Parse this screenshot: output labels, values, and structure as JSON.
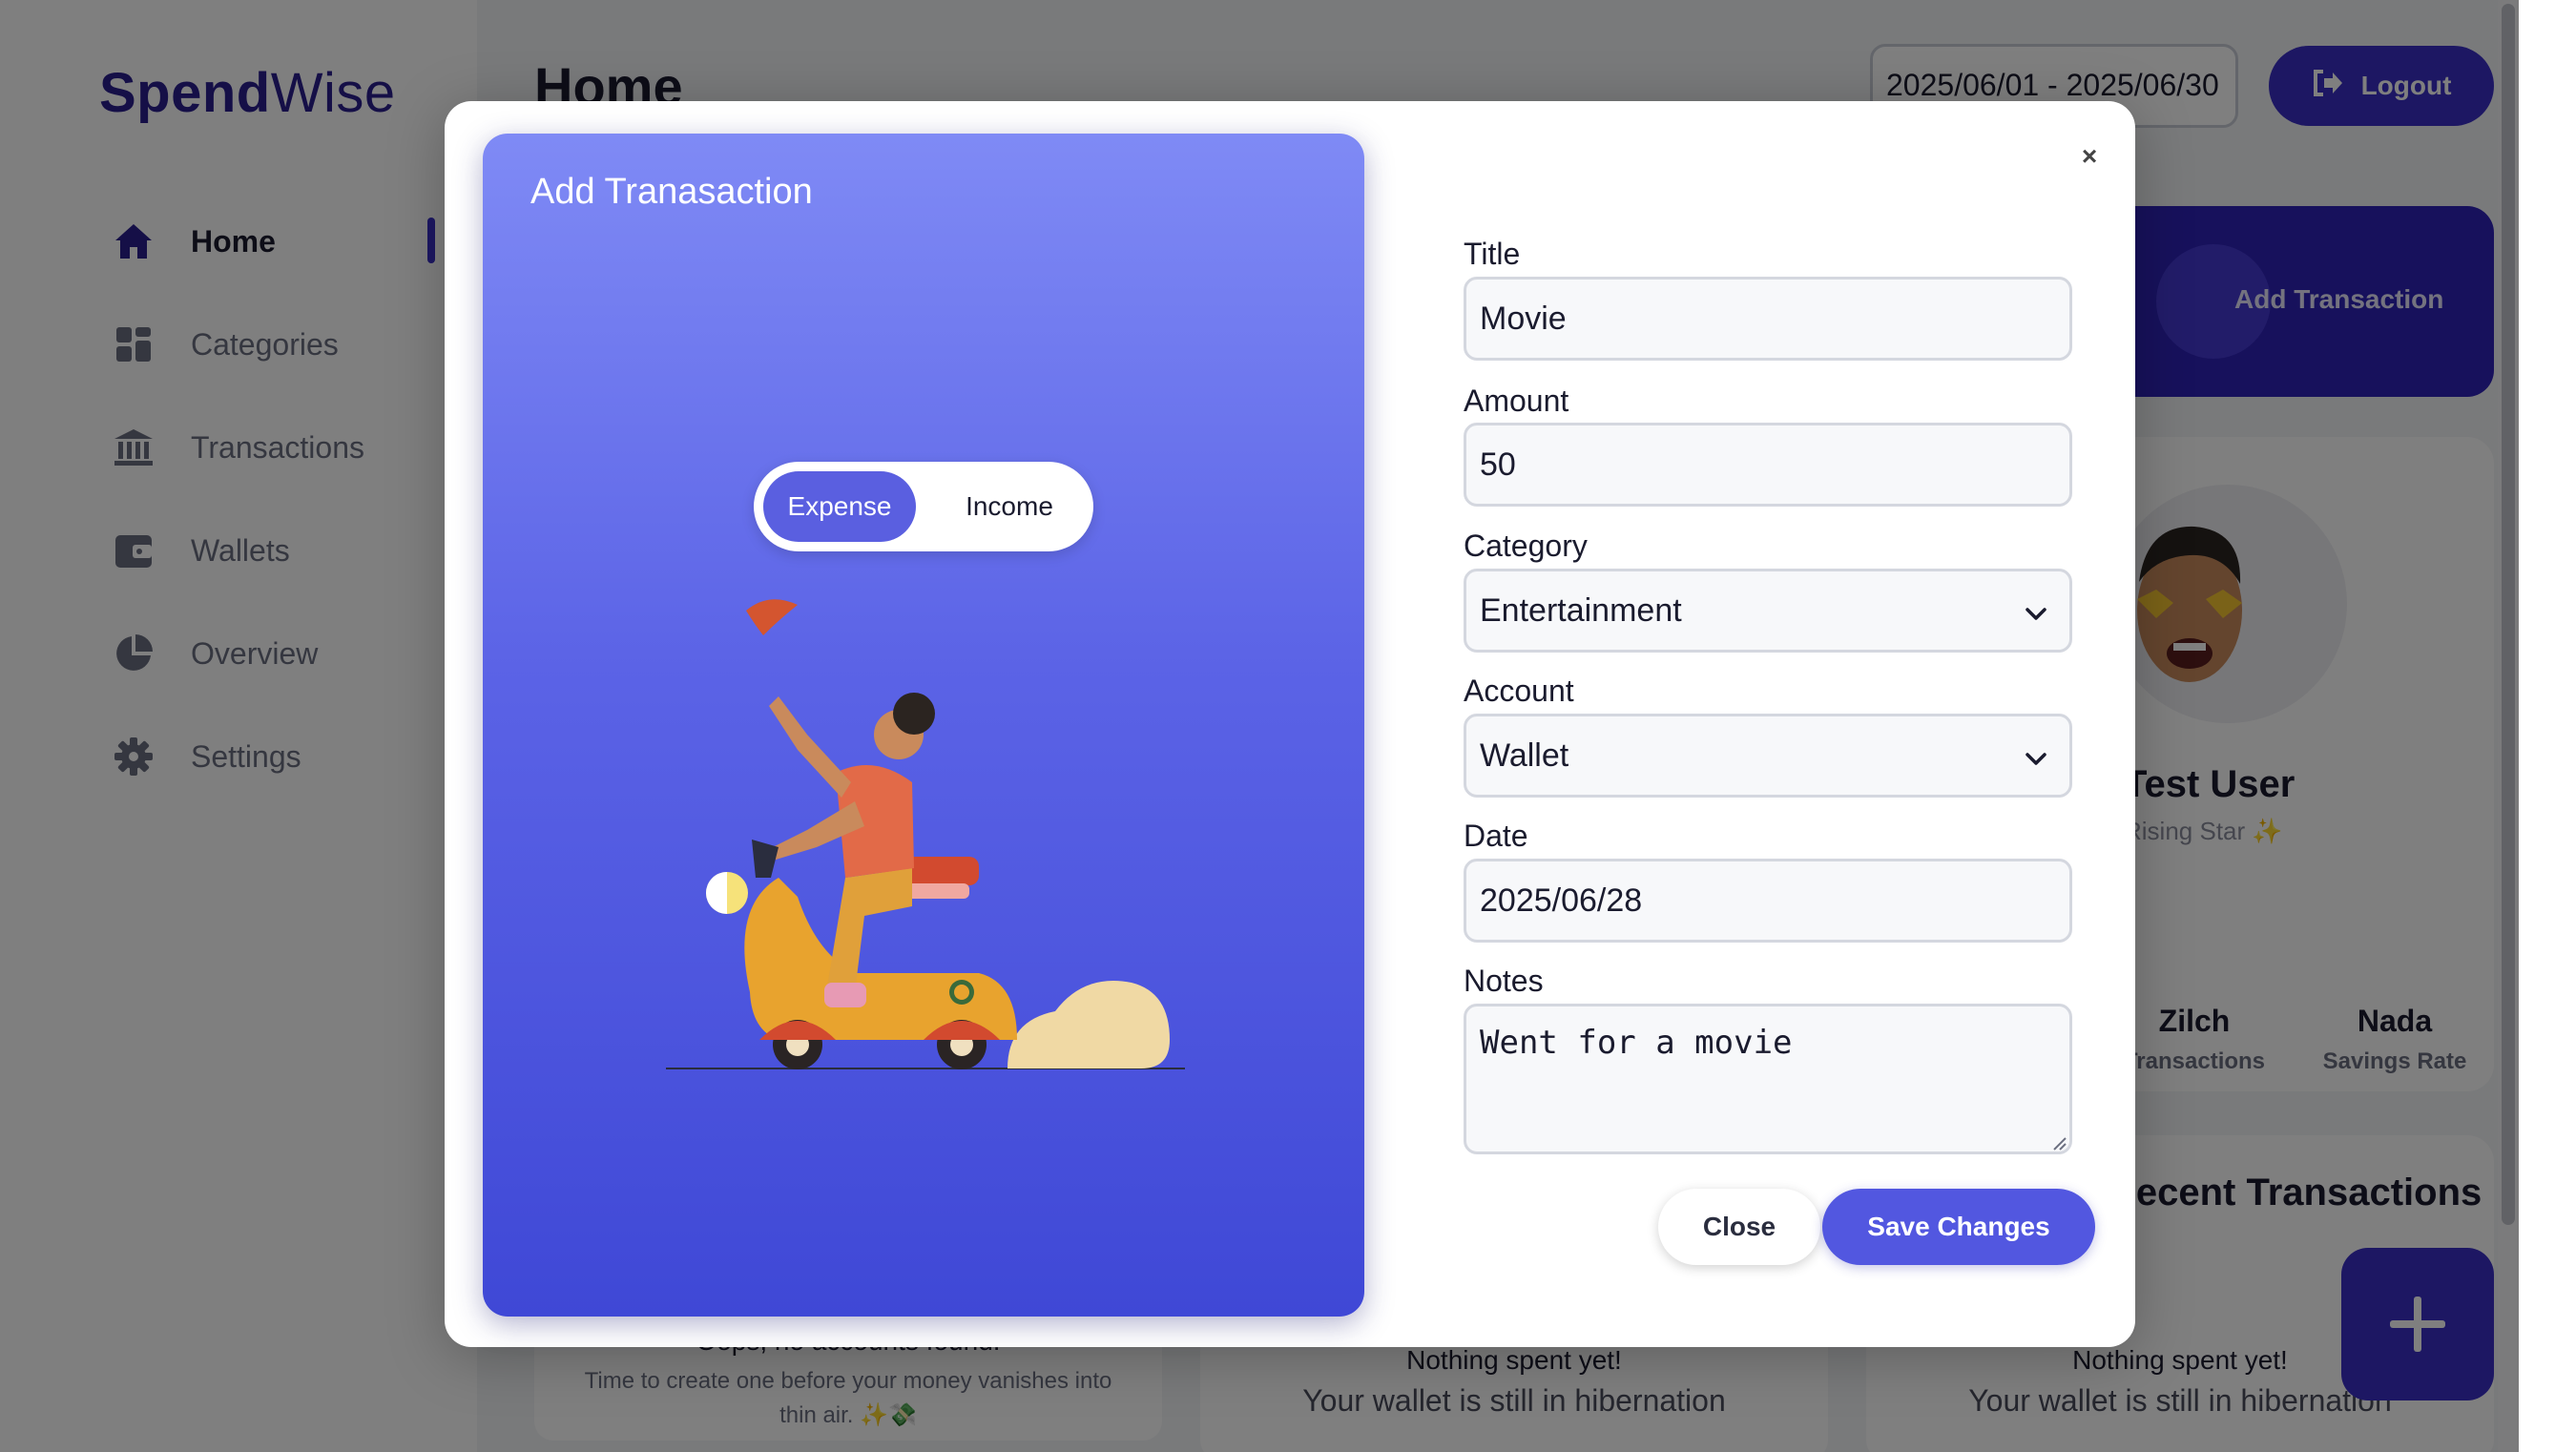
{
  "app": {
    "logo_bold": "Spend",
    "logo_light": "Wise",
    "page_title": "Home",
    "date_range": "2025/06/01 - 2025/06/30",
    "logout_label": "Logout"
  },
  "sidebar": {
    "items": [
      {
        "label": "Home",
        "icon": "home-icon",
        "active": true
      },
      {
        "label": "Categories",
        "icon": "grid-icon"
      },
      {
        "label": "Transactions",
        "icon": "bank-icon"
      },
      {
        "label": "Wallets",
        "icon": "wallet-icon"
      },
      {
        "label": "Overview",
        "icon": "pie-chart-icon"
      },
      {
        "label": "Settings",
        "icon": "gear-icon"
      }
    ]
  },
  "dashboard": {
    "add_transaction_label": "Add Transaction",
    "user_name": "Test User",
    "user_badge": "Rising Star ✨",
    "stats": [
      {
        "value": "Zilch",
        "label": "Transactions"
      },
      {
        "value": "Nada",
        "label": "Savings Rate"
      }
    ],
    "recent_title": "Recent Transactions",
    "empty_accounts_title": "Oops, no accounts found!",
    "empty_accounts_text": "Time to create one before your money vanishes into thin air. ✨💸",
    "empty_spent_title": "Nothing spent yet!",
    "empty_spent_text": "Your wallet is still in hibernation"
  },
  "modal": {
    "heading": "Add Tranasaction",
    "toggle": {
      "expense": "Expense",
      "income": "Income",
      "selected": "Expense"
    },
    "close_symbol": "×",
    "fields": {
      "title_label": "Title",
      "title_value": "Movie",
      "amount_label": "Amount",
      "amount_value": "50",
      "category_label": "Category",
      "category_value": "Entertainment",
      "account_label": "Account",
      "account_value": "Wallet",
      "date_label": "Date",
      "date_value": "2025/06/28",
      "notes_label": "Notes",
      "notes_value": "Went for a movie"
    },
    "close_label": "Close",
    "save_label": "Save Changes"
  },
  "colors": {
    "brand": "#3a2fc7",
    "hero_top": "#7f8af5",
    "hero_bottom": "#3f48d6",
    "save_button": "#5257e0"
  }
}
